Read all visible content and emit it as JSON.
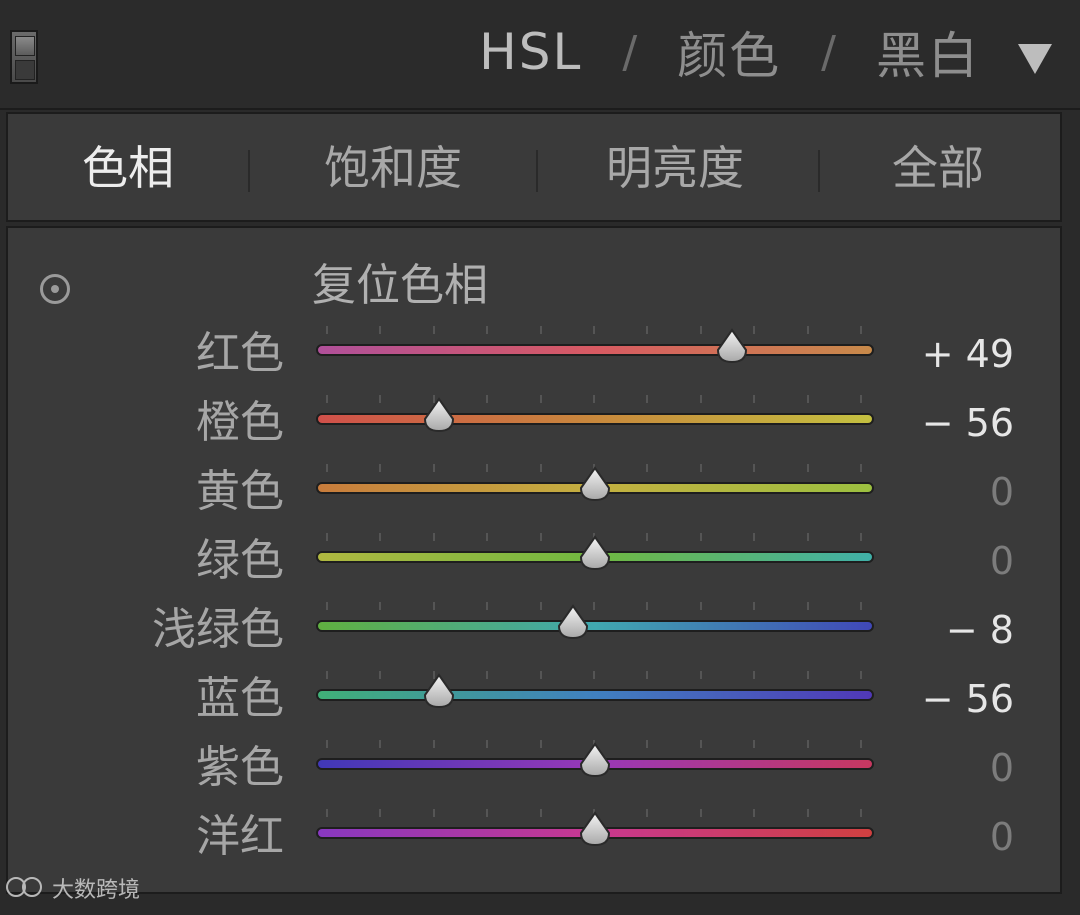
{
  "header": {
    "modes": [
      "HSL",
      "颜色",
      "黑白"
    ],
    "separator": "/",
    "active_mode_index": 0
  },
  "tabs": [
    {
      "label": "色相",
      "active": true
    },
    {
      "label": "饱和度",
      "active": false
    },
    {
      "label": "明亮度",
      "active": false
    },
    {
      "label": "全部",
      "active": false
    }
  ],
  "content": {
    "reset_label": "复位色相",
    "slider_range": [
      -100,
      100
    ],
    "sliders": [
      {
        "label": "红色",
        "value": 49,
        "display": "+ 49",
        "gradient": [
          "#b0509a",
          "#d85a62",
          "#c88a4a"
        ]
      },
      {
        "label": "橙色",
        "value": -56,
        "display": "− 56",
        "gradient": [
          "#d0504a",
          "#c8883c",
          "#c4c040"
        ]
      },
      {
        "label": "黄色",
        "value": 0,
        "display": "0",
        "gradient": [
          "#c87c3c",
          "#c4b040",
          "#9cc040"
        ]
      },
      {
        "label": "绿色",
        "value": 0,
        "display": "0",
        "gradient": [
          "#b0b840",
          "#70b840",
          "#40b0a8"
        ]
      },
      {
        "label": "浅绿色",
        "value": -8,
        "display": "− 8",
        "gradient": [
          "#60b040",
          "#40a8b0",
          "#4048b8"
        ]
      },
      {
        "label": "蓝色",
        "value": -56,
        "display": "− 56",
        "gradient": [
          "#40b078",
          "#4080c0",
          "#5038b8"
        ]
      },
      {
        "label": "紫色",
        "value": 0,
        "display": "0",
        "gradient": [
          "#4038b8",
          "#9838b8",
          "#c83860"
        ]
      },
      {
        "label": "洋红",
        "value": 0,
        "display": "0",
        "gradient": [
          "#8838c0",
          "#c83890",
          "#d04040"
        ]
      }
    ]
  },
  "watermark": {
    "text": "大数跨境"
  }
}
